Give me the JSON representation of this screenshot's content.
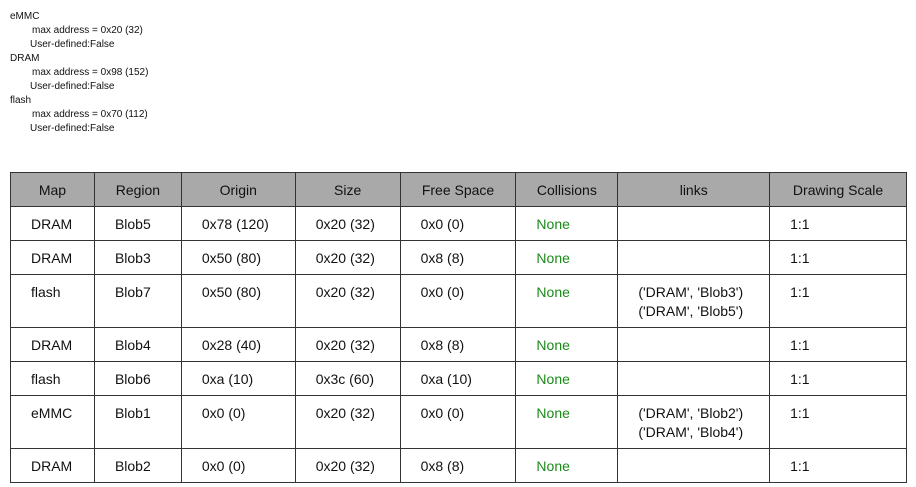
{
  "summary": [
    {
      "map": "eMMC",
      "max_address": "max address = 0x20 (32)",
      "user_defined": "User-defined:False"
    },
    {
      "map": "DRAM",
      "max_address": "max address = 0x98 (152)",
      "user_defined": "User-defined:False"
    },
    {
      "map": "flash",
      "max_address": "max address = 0x70 (112)",
      "user_defined": "User-defined:False"
    }
  ],
  "table": {
    "headers": [
      "Map",
      "Region",
      "Origin",
      "Size",
      "Free Space",
      "Collisions",
      "links",
      "Drawing Scale"
    ],
    "rows": [
      {
        "map": "DRAM",
        "region": "Blob5",
        "origin": "0x78 (120)",
        "size": "0x20 (32)",
        "free": "0x0 (0)",
        "collisions": "None",
        "links": [],
        "scale": "1:1"
      },
      {
        "map": "DRAM",
        "region": "Blob3",
        "origin": "0x50 (80)",
        "size": "0x20 (32)",
        "free": "0x8 (8)",
        "collisions": "None",
        "links": [],
        "scale": "1:1"
      },
      {
        "map": "flash",
        "region": "Blob7",
        "origin": "0x50 (80)",
        "size": "0x20 (32)",
        "free": "0x0 (0)",
        "collisions": "None",
        "links": [
          "('DRAM', 'Blob3')",
          "('DRAM', 'Blob5')"
        ],
        "scale": "1:1"
      },
      {
        "map": "DRAM",
        "region": "Blob4",
        "origin": "0x28 (40)",
        "size": "0x20 (32)",
        "free": "0x8 (8)",
        "collisions": "None",
        "links": [],
        "scale": "1:1"
      },
      {
        "map": "flash",
        "region": "Blob6",
        "origin": "0xa (10)",
        "size": "0x3c (60)",
        "free": "0xa (10)",
        "collisions": "None",
        "links": [],
        "scale": "1:1"
      },
      {
        "map": "eMMC",
        "region": "Blob1",
        "origin": "0x0 (0)",
        "size": "0x20 (32)",
        "free": "0x0 (0)",
        "collisions": "None",
        "links": [
          "('DRAM', 'Blob2')",
          "('DRAM', 'Blob4')"
        ],
        "scale": "1:1"
      },
      {
        "map": "DRAM",
        "region": "Blob2",
        "origin": "0x0 (0)",
        "size": "0x20 (32)",
        "free": "0x8 (8)",
        "collisions": "None",
        "links": [],
        "scale": "1:1"
      }
    ]
  },
  "colors": {
    "header_bg": "#a9a9a9",
    "collision_none": "#1a8a1a"
  }
}
